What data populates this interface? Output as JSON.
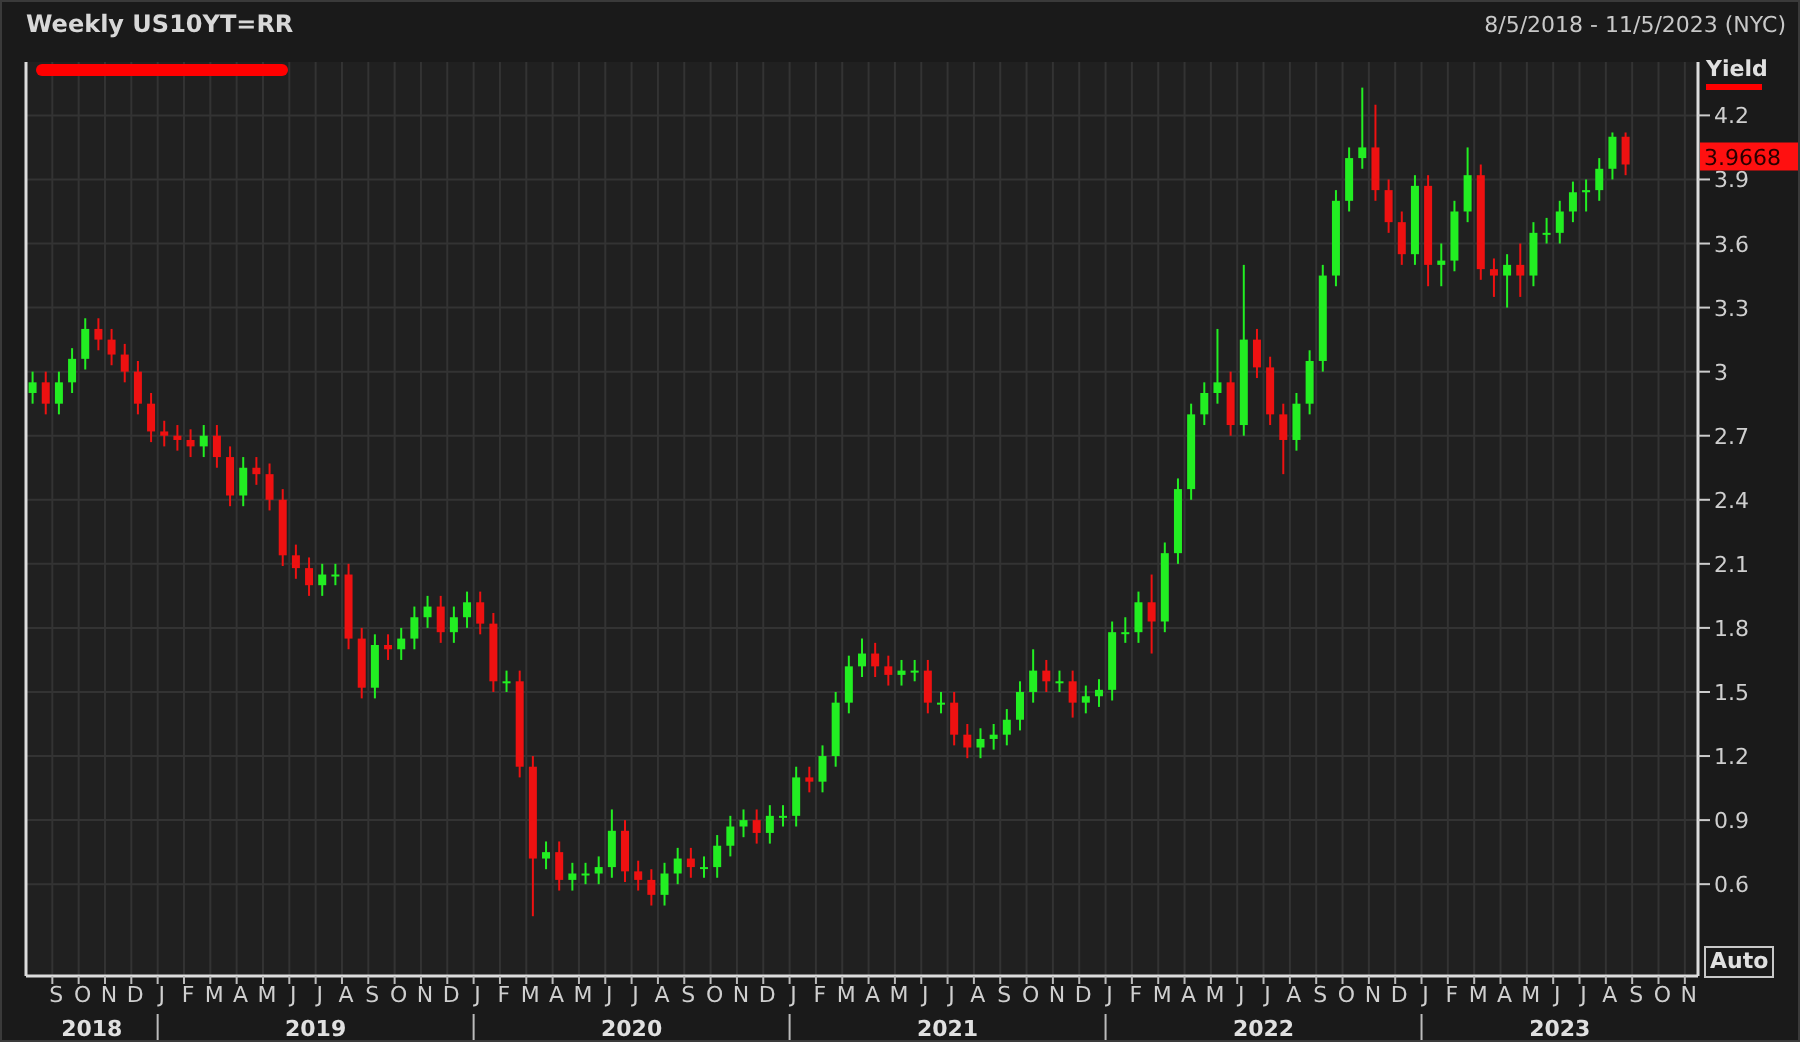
{
  "header": {
    "title": "Weekly US10YT=RR",
    "date_range": "8/5/2018 - 11/5/2023 (NYC)"
  },
  "chart": {
    "legend": {
      "label": "Yield",
      "color": "#ff0000"
    },
    "last_value": "3.9668",
    "auto_button": "Auto",
    "year_bands": [
      "2018",
      "2019",
      "2020",
      "2021",
      "2022",
      "2023"
    ],
    "chart_data": {
      "type": "candlestick",
      "grid": true,
      "ylim": [
        0.17,
        4.45
      ],
      "yticks": [
        0.6,
        0.9,
        1.2,
        1.5,
        1.8,
        2.1,
        2.4,
        2.7,
        3,
        3.3,
        3.6,
        3.9,
        4.2
      ],
      "categories": [
        null,
        null,
        "S",
        null,
        "O",
        null,
        "N",
        null,
        "D",
        null,
        "J",
        null,
        "F",
        null,
        "M",
        null,
        "A",
        null,
        "M",
        null,
        "J",
        null,
        "J",
        null,
        "A",
        null,
        "S",
        null,
        "O",
        null,
        "N",
        null,
        "D",
        null,
        "J",
        null,
        "F",
        null,
        "M",
        null,
        "A",
        null,
        "M",
        null,
        "J",
        null,
        "J",
        null,
        "A",
        null,
        "S",
        null,
        "O",
        null,
        "N",
        null,
        "D",
        null,
        "J",
        null,
        "F",
        null,
        "M",
        null,
        "A",
        null,
        "M",
        null,
        "J",
        null,
        "J",
        null,
        "A",
        null,
        "S",
        null,
        "O",
        null,
        "N",
        null,
        "D",
        null,
        "J",
        null,
        "F",
        null,
        "M",
        null,
        "A",
        null,
        "M",
        null,
        "J",
        null,
        "J",
        null,
        "A",
        null,
        "S",
        null,
        "O",
        null,
        "N",
        null,
        "D",
        null,
        "J",
        null,
        "F",
        null,
        "M",
        null,
        "A",
        null,
        "M",
        null,
        "J",
        null,
        "J",
        null,
        "A",
        null,
        "S",
        null,
        "O",
        null,
        "N"
      ],
      "ohlc": [
        [
          2.9,
          3.0,
          2.85,
          2.95
        ],
        [
          2.95,
          3.0,
          2.8,
          2.85
        ],
        [
          2.85,
          3.0,
          2.8,
          2.95
        ],
        [
          2.95,
          3.11,
          2.9,
          3.06
        ],
        [
          3.06,
          3.25,
          3.01,
          3.2
        ],
        [
          3.2,
          3.25,
          3.1,
          3.15
        ],
        [
          3.15,
          3.2,
          3.03,
          3.08
        ],
        [
          3.08,
          3.13,
          2.95,
          3.0
        ],
        [
          3.0,
          3.05,
          2.8,
          2.85
        ],
        [
          2.85,
          2.9,
          2.67,
          2.72
        ],
        [
          2.72,
          2.77,
          2.65,
          2.7
        ],
        [
          2.7,
          2.75,
          2.63,
          2.68
        ],
        [
          2.68,
          2.73,
          2.6,
          2.65
        ],
        [
          2.65,
          2.75,
          2.6,
          2.7
        ],
        [
          2.7,
          2.75,
          2.55,
          2.6
        ],
        [
          2.6,
          2.65,
          2.37,
          2.42
        ],
        [
          2.42,
          2.6,
          2.37,
          2.55
        ],
        [
          2.55,
          2.6,
          2.47,
          2.52
        ],
        [
          2.52,
          2.57,
          2.35,
          2.4
        ],
        [
          2.4,
          2.45,
          2.09,
          2.14
        ],
        [
          2.14,
          2.19,
          2.03,
          2.08
        ],
        [
          2.08,
          2.13,
          1.95,
          2.0
        ],
        [
          2.0,
          2.1,
          1.95,
          2.05
        ],
        [
          2.05,
          2.1,
          2.0,
          2.05
        ],
        [
          2.05,
          2.1,
          1.7,
          1.75
        ],
        [
          1.75,
          1.8,
          1.47,
          1.52
        ],
        [
          1.52,
          1.77,
          1.47,
          1.72
        ],
        [
          1.72,
          1.77,
          1.65,
          1.7
        ],
        [
          1.7,
          1.8,
          1.65,
          1.75
        ],
        [
          1.75,
          1.9,
          1.7,
          1.85
        ],
        [
          1.85,
          1.95,
          1.8,
          1.9
        ],
        [
          1.9,
          1.95,
          1.73,
          1.78
        ],
        [
          1.78,
          1.9,
          1.73,
          1.85
        ],
        [
          1.85,
          1.97,
          1.8,
          1.92
        ],
        [
          1.92,
          1.97,
          1.77,
          1.82
        ],
        [
          1.82,
          1.87,
          1.5,
          1.55
        ],
        [
          1.55,
          1.6,
          1.5,
          1.55
        ],
        [
          1.55,
          1.6,
          1.1,
          1.15
        ],
        [
          1.15,
          1.2,
          0.45,
          0.72
        ],
        [
          0.72,
          0.8,
          0.67,
          0.75
        ],
        [
          0.75,
          0.8,
          0.57,
          0.62
        ],
        [
          0.62,
          0.7,
          0.57,
          0.65
        ],
        [
          0.65,
          0.7,
          0.6,
          0.65
        ],
        [
          0.65,
          0.73,
          0.6,
          0.68
        ],
        [
          0.68,
          0.95,
          0.63,
          0.85
        ],
        [
          0.85,
          0.9,
          0.61,
          0.66
        ],
        [
          0.66,
          0.71,
          0.57,
          0.62
        ],
        [
          0.62,
          0.67,
          0.5,
          0.55
        ],
        [
          0.55,
          0.7,
          0.5,
          0.65
        ],
        [
          0.65,
          0.77,
          0.6,
          0.72
        ],
        [
          0.72,
          0.77,
          0.63,
          0.68
        ],
        [
          0.68,
          0.73,
          0.63,
          0.68
        ],
        [
          0.68,
          0.83,
          0.63,
          0.78
        ],
        [
          0.78,
          0.92,
          0.73,
          0.87
        ],
        [
          0.87,
          0.95,
          0.82,
          0.9
        ],
        [
          0.9,
          0.95,
          0.79,
          0.84
        ],
        [
          0.84,
          0.97,
          0.79,
          0.92
        ],
        [
          0.92,
          0.97,
          0.87,
          0.92
        ],
        [
          0.92,
          1.15,
          0.87,
          1.1
        ],
        [
          1.1,
          1.15,
          1.03,
          1.08
        ],
        [
          1.08,
          1.25,
          1.03,
          1.2
        ],
        [
          1.2,
          1.5,
          1.15,
          1.45
        ],
        [
          1.45,
          1.67,
          1.4,
          1.62
        ],
        [
          1.62,
          1.75,
          1.57,
          1.68
        ],
        [
          1.68,
          1.73,
          1.57,
          1.62
        ],
        [
          1.62,
          1.67,
          1.53,
          1.58
        ],
        [
          1.58,
          1.65,
          1.53,
          1.6
        ],
        [
          1.6,
          1.65,
          1.55,
          1.6
        ],
        [
          1.6,
          1.65,
          1.4,
          1.45
        ],
        [
          1.45,
          1.5,
          1.4,
          1.45
        ],
        [
          1.45,
          1.5,
          1.25,
          1.3
        ],
        [
          1.3,
          1.35,
          1.19,
          1.24
        ],
        [
          1.24,
          1.33,
          1.19,
          1.28
        ],
        [
          1.28,
          1.35,
          1.23,
          1.3
        ],
        [
          1.3,
          1.42,
          1.25,
          1.37
        ],
        [
          1.37,
          1.55,
          1.32,
          1.5
        ],
        [
          1.5,
          1.7,
          1.45,
          1.6
        ],
        [
          1.6,
          1.65,
          1.5,
          1.55
        ],
        [
          1.55,
          1.6,
          1.5,
          1.55
        ],
        [
          1.55,
          1.6,
          1.38,
          1.45
        ],
        [
          1.45,
          1.53,
          1.4,
          1.48
        ],
        [
          1.48,
          1.56,
          1.43,
          1.51
        ],
        [
          1.51,
          1.83,
          1.46,
          1.78
        ],
        [
          1.78,
          1.85,
          1.73,
          1.78
        ],
        [
          1.78,
          1.97,
          1.73,
          1.92
        ],
        [
          1.92,
          2.05,
          1.68,
          1.83
        ],
        [
          1.83,
          2.2,
          1.78,
          2.15
        ],
        [
          2.15,
          2.5,
          2.1,
          2.45
        ],
        [
          2.45,
          2.85,
          2.4,
          2.8
        ],
        [
          2.8,
          2.95,
          2.75,
          2.9
        ],
        [
          2.9,
          3.2,
          2.85,
          2.95
        ],
        [
          2.95,
          3.0,
          2.7,
          2.75
        ],
        [
          2.75,
          3.5,
          2.7,
          3.15
        ],
        [
          3.15,
          3.2,
          2.97,
          3.02
        ],
        [
          3.02,
          3.07,
          2.75,
          2.8
        ],
        [
          2.8,
          2.85,
          2.52,
          2.68
        ],
        [
          2.68,
          2.9,
          2.63,
          2.85
        ],
        [
          2.85,
          3.1,
          2.8,
          3.05
        ],
        [
          3.05,
          3.5,
          3.0,
          3.45
        ],
        [
          3.45,
          3.85,
          3.4,
          3.8
        ],
        [
          3.8,
          4.05,
          3.75,
          4.0
        ],
        [
          4.0,
          4.33,
          3.95,
          4.05
        ],
        [
          4.05,
          4.25,
          3.8,
          3.85
        ],
        [
          3.85,
          3.9,
          3.65,
          3.7
        ],
        [
          3.7,
          3.75,
          3.5,
          3.55
        ],
        [
          3.55,
          3.92,
          3.5,
          3.87
        ],
        [
          3.87,
          3.92,
          3.4,
          3.5
        ],
        [
          3.5,
          3.6,
          3.4,
          3.52
        ],
        [
          3.52,
          3.8,
          3.47,
          3.75
        ],
        [
          3.75,
          4.05,
          3.7,
          3.92
        ],
        [
          3.92,
          3.97,
          3.43,
          3.48
        ],
        [
          3.48,
          3.53,
          3.35,
          3.45
        ],
        [
          3.45,
          3.55,
          3.3,
          3.5
        ],
        [
          3.5,
          3.6,
          3.35,
          3.45
        ],
        [
          3.45,
          3.7,
          3.4,
          3.65
        ],
        [
          3.65,
          3.72,
          3.6,
          3.65
        ],
        [
          3.65,
          3.8,
          3.6,
          3.75
        ],
        [
          3.75,
          3.89,
          3.7,
          3.84
        ],
        [
          3.84,
          3.9,
          3.75,
          3.85
        ],
        [
          3.85,
          4.0,
          3.8,
          3.95
        ],
        [
          3.95,
          4.12,
          3.9,
          4.1
        ],
        [
          4.1,
          4.12,
          3.92,
          3.97
        ],
        null,
        null,
        null,
        null,
        null
      ]
    }
  }
}
